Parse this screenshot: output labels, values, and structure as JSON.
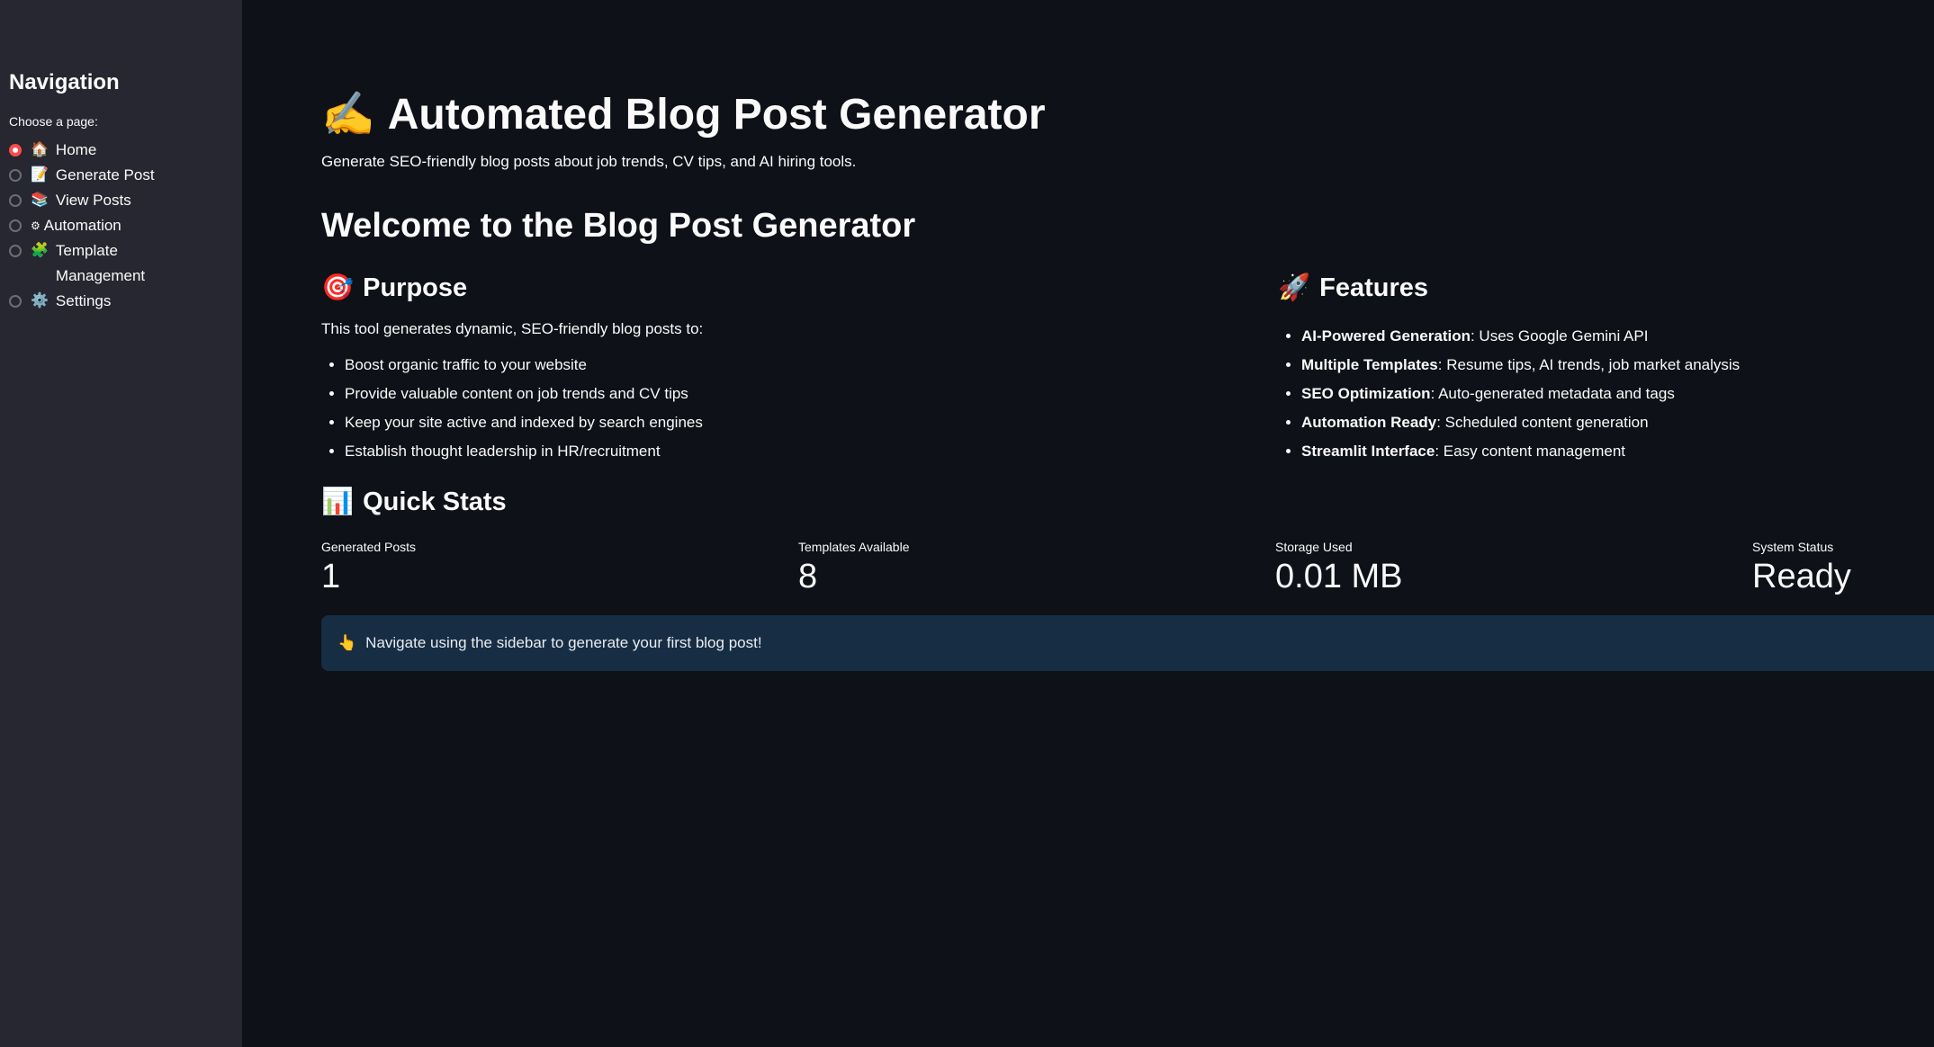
{
  "sidebar": {
    "title": "Navigation",
    "radio_label": "Choose a page:",
    "items": [
      {
        "icon": "🏠",
        "label": "Home",
        "selected": true
      },
      {
        "icon": "📝",
        "label": "Generate Post",
        "selected": false
      },
      {
        "icon": "📚",
        "label": "View Posts",
        "selected": false
      },
      {
        "icon": "⚙",
        "label": "Automation",
        "selected": false
      },
      {
        "icon": "🧩",
        "label": "Template Management",
        "selected": false
      },
      {
        "icon": "⚙️",
        "label": "Settings",
        "selected": false
      }
    ]
  },
  "main": {
    "title_emoji": "✍️",
    "title": "Automated Blog Post Generator",
    "subtitle": "Generate SEO-friendly blog posts about job trends, CV tips, and AI hiring tools.",
    "welcome_heading": "Welcome to the Blog Post Generator",
    "purpose": {
      "emoji": "🎯",
      "heading": "Purpose",
      "intro": "This tool generates dynamic, SEO-friendly blog posts to:",
      "bullets": [
        "Boost organic traffic to your website",
        "Provide valuable content on job trends and CV tips",
        "Keep your site active and indexed by search engines",
        "Establish thought leadership in HR/recruitment"
      ]
    },
    "features": {
      "emoji": "🚀",
      "heading": "Features",
      "items": [
        {
          "bold": "AI-Powered Generation",
          "text": ": Uses Google Gemini API"
        },
        {
          "bold": "Multiple Templates",
          "text": ": Resume tips, AI trends, job market analysis"
        },
        {
          "bold": "SEO Optimization",
          "text": ": Auto-generated metadata and tags"
        },
        {
          "bold": "Automation Ready",
          "text": ": Scheduled content generation"
        },
        {
          "bold": "Streamlit Interface",
          "text": ": Easy content management"
        }
      ]
    },
    "stats": {
      "emoji": "📊",
      "heading": "Quick Stats",
      "items": [
        {
          "label": "Generated Posts",
          "value": "1"
        },
        {
          "label": "Templates Available",
          "value": "8"
        },
        {
          "label": "Storage Used",
          "value": "0.01 MB"
        },
        {
          "label": "System Status",
          "value": "Ready"
        }
      ]
    },
    "info": {
      "emoji": "👆",
      "text": "Navigate using the sidebar to generate your first blog post!"
    }
  },
  "colors": {
    "background": "#0e1117",
    "sidebar": "#262730",
    "accent": "#ff4b4b",
    "info_bg": "#172d43"
  }
}
